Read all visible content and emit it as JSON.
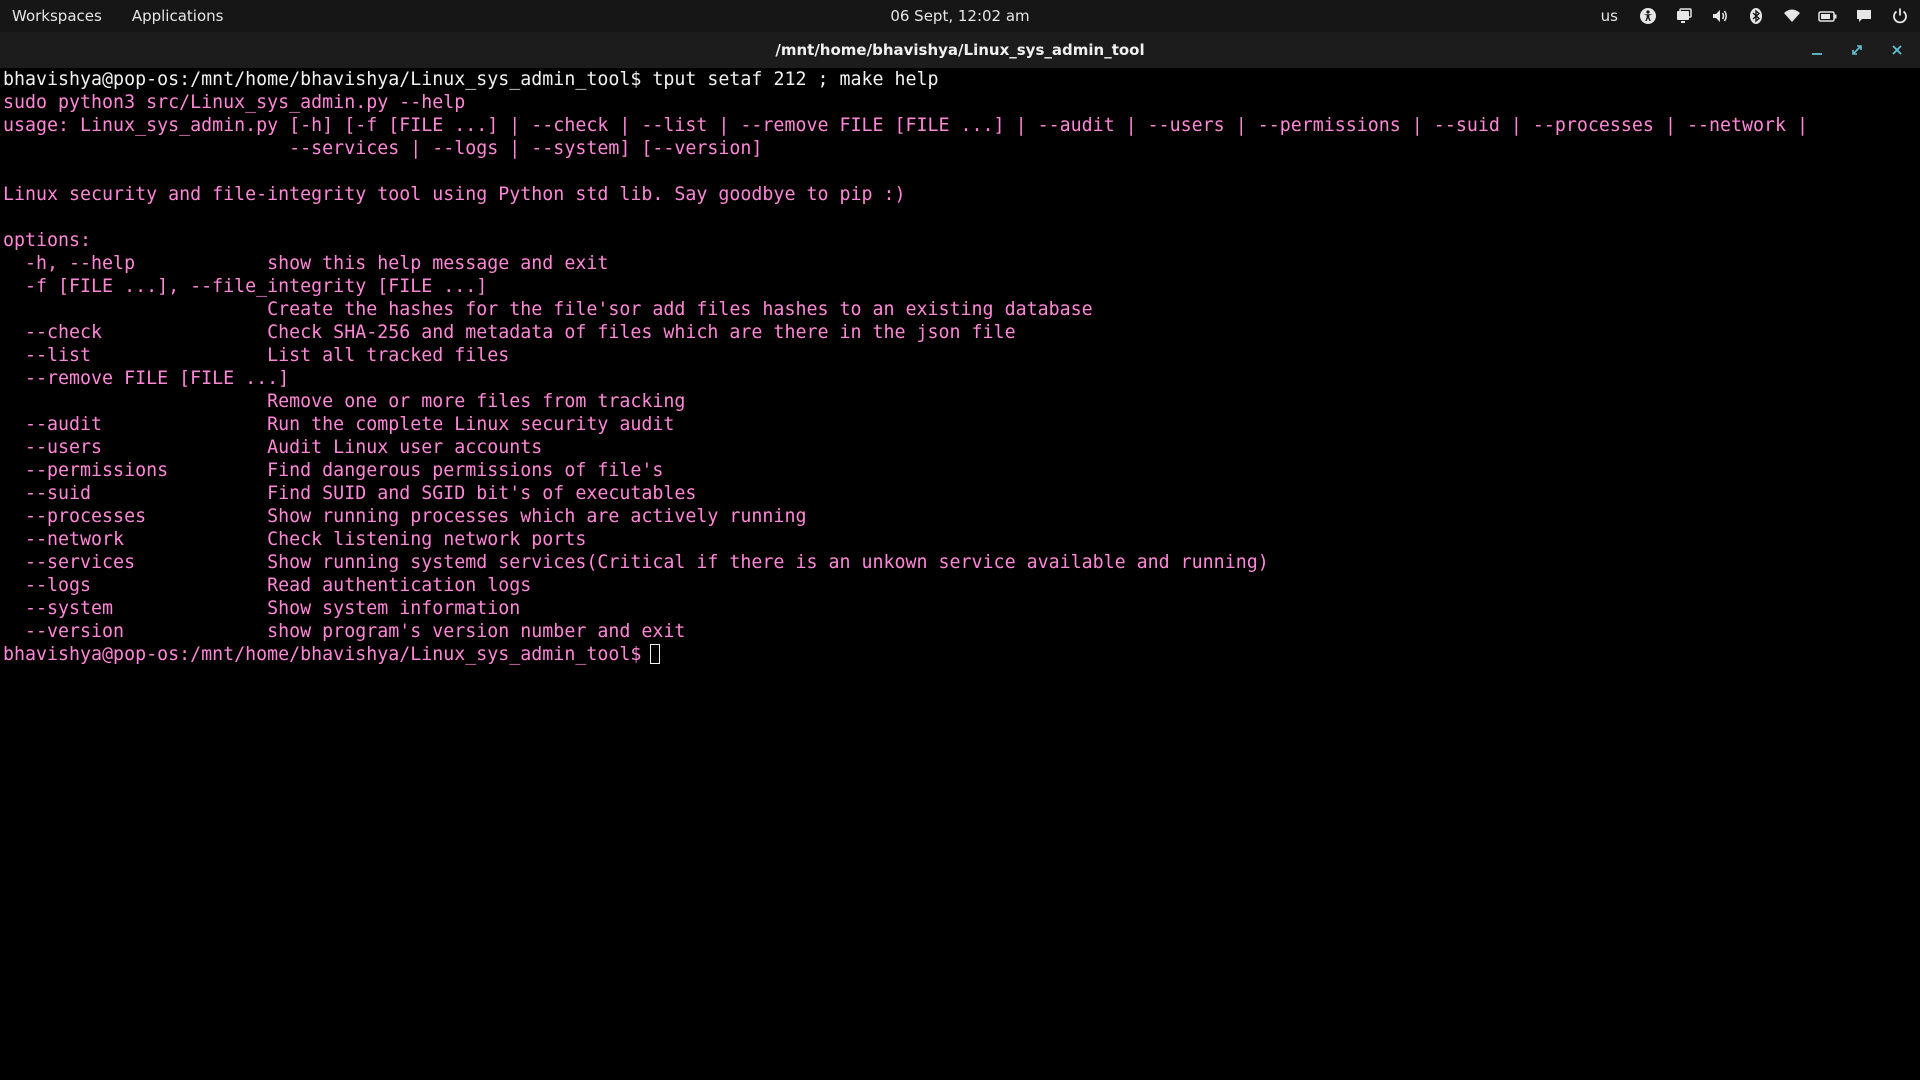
{
  "topbar": {
    "workspaces_label": "Workspaces",
    "applications_label": "Applications",
    "clock": "06 Sept, 12:02 am",
    "keyboard_layout": "us",
    "tray_icons": [
      "accessibility-icon",
      "screen-share-icon",
      "volume-icon",
      "bluetooth-icon",
      "wifi-icon",
      "battery-icon",
      "notifications-icon",
      "power-icon"
    ]
  },
  "window": {
    "title": "/mnt/home/bhavishya/Linux_sys_admin_tool",
    "controls": [
      "minimize-icon",
      "maximize-icon",
      "close-icon"
    ]
  },
  "terminal": {
    "prompt": "bhavishya@pop-os:/mnt/home/bhavishya/Linux_sys_admin_tool$",
    "command": " tput setaf 212 ; make help",
    "output_lines": [
      "sudo python3 src/Linux_sys_admin.py --help",
      "usage: Linux_sys_admin.py [-h] [-f [FILE ...] | --check | --list | --remove FILE [FILE ...] | --audit | --users | --permissions | --suid | --processes | --network |",
      "                          --services | --logs | --system] [--version]",
      "",
      "Linux security and file-integrity tool using Python std lib. Say goodbye to pip :)",
      "",
      "options:",
      "  -h, --help            show this help message and exit",
      "  -f [FILE ...], --file_integrity [FILE ...]",
      "                        Create the hashes for the file'sor add files hashes to an existing database",
      "  --check               Check SHA-256 and metadata of files which are there in the json file",
      "  --list                List all tracked files",
      "  --remove FILE [FILE ...]",
      "                        Remove one or more files from tracking",
      "  --audit               Run the complete Linux security audit",
      "  --users               Audit Linux user accounts",
      "  --permissions         Find dangerous permissions of file's",
      "  --suid                Find SUID and SGID bit's of executables",
      "  --processes           Show running processes which are actively running",
      "  --network             Check listening network ports",
      "  --services            Show running systemd services(Critical if there is an unkown service available and running)",
      "  --logs                Read authentication logs",
      "  --system              Show system information",
      "  --version             show program's version number and exit"
    ],
    "final_prompt": "bhavishya@pop-os:/mnt/home/bhavishya/Linux_sys_admin_tool$"
  },
  "colors": {
    "prompt_text": "#f2f2f2",
    "output_text": "#ff87d7",
    "window_controls": "#61c2d6",
    "background": "#000000"
  }
}
